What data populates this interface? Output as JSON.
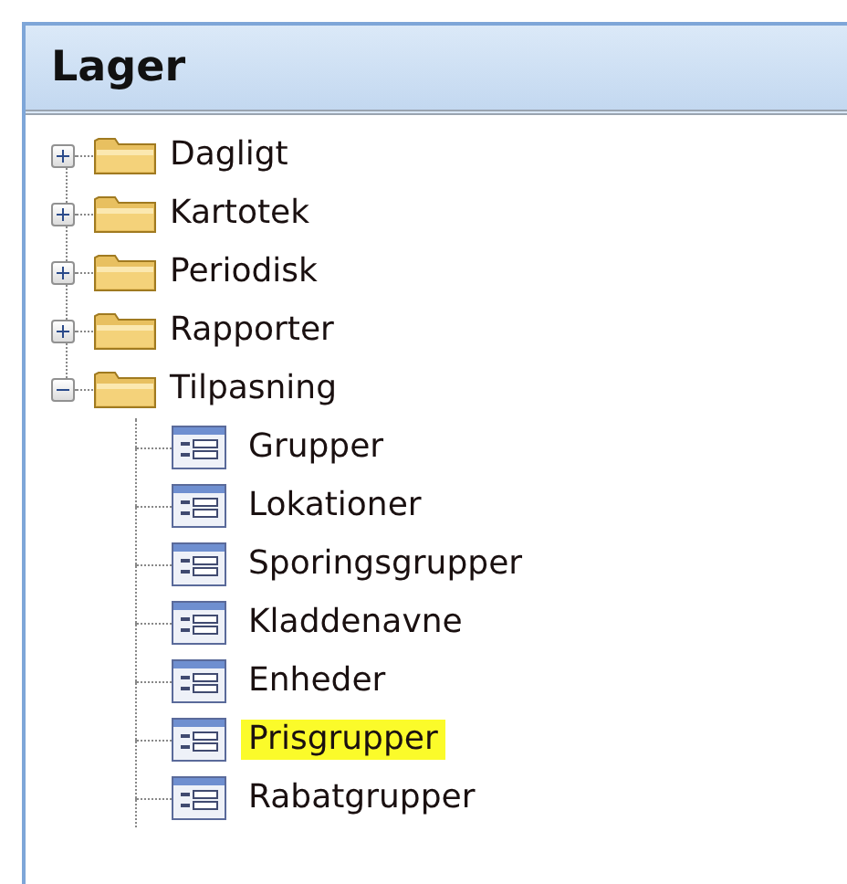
{
  "panel": {
    "title": "Lager"
  },
  "tree": [
    {
      "label": "Dagligt",
      "expanded": false
    },
    {
      "label": "Kartotek",
      "expanded": false
    },
    {
      "label": "Periodisk",
      "expanded": false
    },
    {
      "label": "Rapporter",
      "expanded": false
    },
    {
      "label": "Tilpasning",
      "expanded": true,
      "children": [
        {
          "label": "Grupper",
          "highlighted": false
        },
        {
          "label": "Lokationer",
          "highlighted": false
        },
        {
          "label": "Sporingsgrupper",
          "highlighted": false
        },
        {
          "label": "Kladdenavne",
          "highlighted": false
        },
        {
          "label": "Enheder",
          "highlighted": false
        },
        {
          "label": "Prisgrupper",
          "highlighted": true
        },
        {
          "label": "Rabatgrupper",
          "highlighted": false
        }
      ]
    }
  ]
}
